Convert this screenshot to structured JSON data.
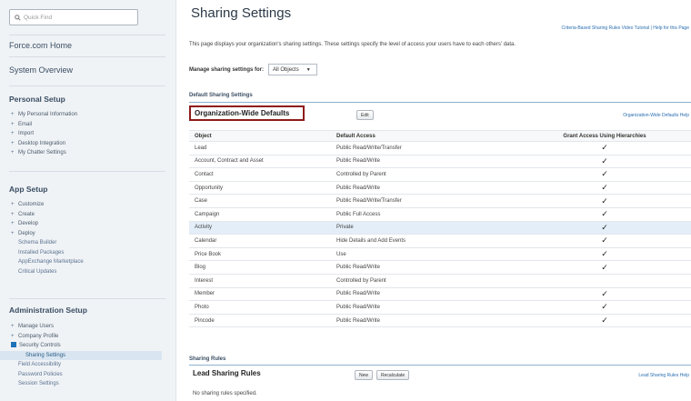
{
  "sidebar": {
    "quick_find_placeholder": "Quick Find",
    "forcecom_home": "Force.com Home",
    "system_overview": "System Overview",
    "personal_setup": {
      "title": "Personal Setup",
      "items": [
        "My Personal Information",
        "Email",
        "Import",
        "Desktop Integration",
        "My Chatter Settings"
      ]
    },
    "app_setup": {
      "title": "App Setup",
      "items": [
        "Customize",
        "Create",
        "Develop",
        "Deploy"
      ],
      "leaves": [
        "Schema Builder",
        "Installed Packages",
        "AppExchange Marketplace",
        "Critical Updates"
      ]
    },
    "admin_setup": {
      "title": "Administration Setup",
      "items": [
        "Manage Users",
        "Company Profile",
        "Security Controls"
      ],
      "leaves": [
        "Sharing Settings",
        "Field Accessibility",
        "Password Policies",
        "Session Settings"
      ]
    }
  },
  "main": {
    "title": "Sharing Settings",
    "help_link": "Criteria-Based Sharing Rules Video Tutorial | Help for this Page",
    "description": "This page displays your organization's sharing settings. These settings specify the level of access your users have to each others' data.",
    "manage_label": "Manage sharing settings for:",
    "manage_value": "All Objects",
    "default_sharing_label": "Default Sharing Settings",
    "org_wide_title": "Organization-Wide Defaults",
    "edit_label": "Edit",
    "org_wide_help": "Organization-Wide Defaults Help",
    "columns": [
      "Object",
      "Default Access",
      "Grant Access Using Hierarchies"
    ],
    "rows": [
      {
        "object": "Lead",
        "access": "Public Read/Write/Transfer",
        "grant": "✓"
      },
      {
        "object": "Account, Contract and Asset",
        "access": "Public Read/Write",
        "grant": "✓"
      },
      {
        "object": "Contact",
        "access": "Controlled by Parent",
        "grant": "✓"
      },
      {
        "object": "Opportunity",
        "access": "Public Read/Write",
        "grant": "✓"
      },
      {
        "object": "Case",
        "access": "Public Read/Write/Transfer",
        "grant": "✓"
      },
      {
        "object": "Campaign",
        "access": "Public Full Access",
        "grant": "✓"
      },
      {
        "object": "Activity",
        "access": "Private",
        "grant": "✓"
      },
      {
        "object": "Calendar",
        "access": "Hide Details and Add Events",
        "grant": "✓"
      },
      {
        "object": "Price Book",
        "access": "Use",
        "grant": "✓"
      },
      {
        "object": "Blog",
        "access": "Public Read/Write",
        "grant": "✓"
      },
      {
        "object": "Interest",
        "access": "Controlled by Parent",
        "grant": ""
      },
      {
        "object": "Member",
        "access": "Public Read/Write",
        "grant": "✓"
      },
      {
        "object": "Photo",
        "access": "Public Read/Write",
        "grant": "✓"
      },
      {
        "object": "Pincode",
        "access": "Public Read/Write",
        "grant": "✓"
      }
    ],
    "sharing_rules_label": "Sharing Rules",
    "lead_rules_title": "Lead Sharing Rules",
    "new_label": "New",
    "recalc_label": "Recalculate",
    "lead_rules_help": "Lead Sharing Rules Help",
    "no_rules": "No sharing rules specified."
  }
}
